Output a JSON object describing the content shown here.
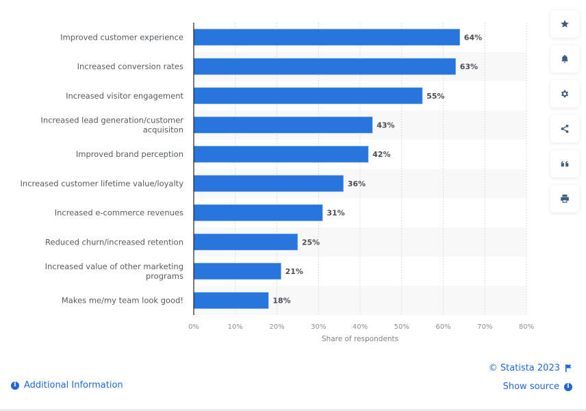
{
  "chart_data": {
    "type": "bar",
    "orientation": "horizontal",
    "categories": [
      "Improved customer experience",
      "Increased conversion rates",
      "Increased visitor engagement",
      "Increased lead generation/customer acquisiton",
      "Improved brand perception",
      "Increased customer lifetime value/loyalty",
      "Increased e-commerce revenues",
      "Reduced churn/increased retention",
      "Increased value of other marketing programs",
      "Makes me/my team look good!"
    ],
    "category_label_lines": [
      [
        "Improved customer experience"
      ],
      [
        "Increased conversion rates"
      ],
      [
        "Increased visitor engagement"
      ],
      [
        "Increased lead generation/customer",
        "acquisiton"
      ],
      [
        "Improved brand perception"
      ],
      [
        "Increased customer lifetime value/loyalty"
      ],
      [
        "Increased e-commerce revenues"
      ],
      [
        "Reduced churn/increased retention"
      ],
      [
        "Increased value of other marketing",
        "programs"
      ],
      [
        "Makes me/my team look good!"
      ]
    ],
    "values": [
      64,
      63,
      55,
      43,
      42,
      36,
      31,
      25,
      21,
      18
    ],
    "data_labels": [
      "64%",
      "63%",
      "55%",
      "43%",
      "42%",
      "36%",
      "31%",
      "25%",
      "21%",
      "18%"
    ],
    "unit": "%",
    "title": "",
    "xlabel": "Share of respondents",
    "ylabel": "",
    "xlim": [
      0,
      80
    ],
    "x_ticks": [
      0,
      10,
      20,
      30,
      40,
      50,
      60,
      70,
      80
    ],
    "x_tick_labels": [
      "0%",
      "10%",
      "20%",
      "30%",
      "40%",
      "50%",
      "60%",
      "70%",
      "80%"
    ],
    "grid": true,
    "legend": "none",
    "colors": {
      "bar": "#2876dd",
      "band_alt": "#f8f8f8",
      "axis": "#222222",
      "grid": "#dcdcdc"
    }
  },
  "toolbar": {
    "buttons": [
      {
        "name": "favorite",
        "icon": "star-icon"
      },
      {
        "name": "notifications",
        "icon": "bell-icon"
      },
      {
        "name": "settings",
        "icon": "gear-icon"
      },
      {
        "name": "share",
        "icon": "share-icon"
      },
      {
        "name": "cite",
        "icon": "quote-icon"
      },
      {
        "name": "print",
        "icon": "print-icon"
      }
    ],
    "icon_color": "#3f5c82"
  },
  "footer": {
    "additional_info_label": "Additional Information",
    "copyright": "© Statista 2023",
    "show_source_label": "Show source",
    "link_color": "#1f67d2"
  }
}
